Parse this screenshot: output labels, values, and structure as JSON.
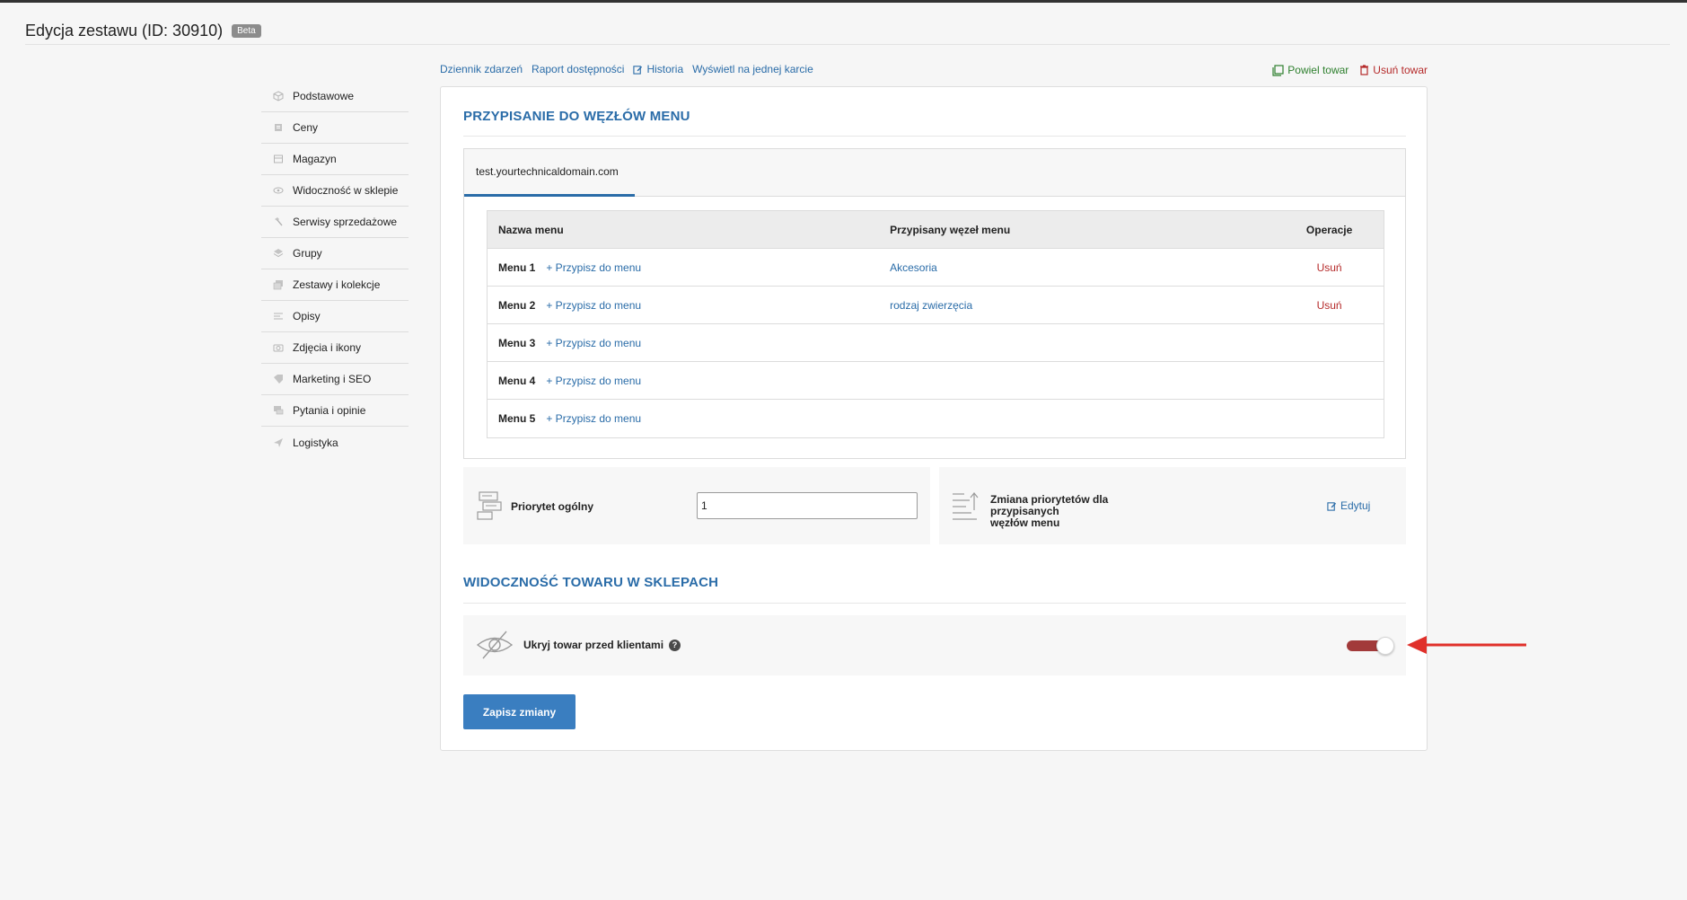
{
  "page": {
    "title": "Edycja zestawu (ID: 30910)",
    "badge": "Beta"
  },
  "sidebar": {
    "items": [
      {
        "label": "Podstawowe",
        "icon": "cube-icon"
      },
      {
        "label": "Ceny",
        "icon": "price-icon"
      },
      {
        "label": "Magazyn",
        "icon": "warehouse-icon"
      },
      {
        "label": "Widoczność w sklepie",
        "icon": "eye-icon"
      },
      {
        "label": "Serwisy sprzedażowe",
        "icon": "hammer-icon"
      },
      {
        "label": "Grupy",
        "icon": "layers-icon"
      },
      {
        "label": "Zestawy i kolekcje",
        "icon": "stack-icon"
      },
      {
        "label": "Opisy",
        "icon": "lines-icon"
      },
      {
        "label": "Zdjęcia i ikony",
        "icon": "camera-icon"
      },
      {
        "label": "Marketing i SEO",
        "icon": "tag-icon"
      },
      {
        "label": "Pytania i opinie",
        "icon": "chat-icon"
      },
      {
        "label": "Logistyka",
        "icon": "send-icon"
      }
    ]
  },
  "toplinks": {
    "events": "Dziennik zdarzeń",
    "availability": "Raport dostępności",
    "history": "Historia",
    "single_card": "Wyświetl na jednej karcie",
    "duplicate": "Powiel towar",
    "delete": "Usuń towar"
  },
  "menu_section": {
    "title": "PRZYPISANIE DO WĘZŁÓW MENU",
    "tab": "test.yourtechnicaldomain.com",
    "columns": {
      "name": "Nazwa menu",
      "node": "Przypisany węzeł menu",
      "ops": "Operacje"
    },
    "rows": [
      {
        "name": "Menu 1",
        "assign": "+ Przypisz do menu",
        "node": "Akcesoria",
        "op": "Usuń"
      },
      {
        "name": "Menu 2",
        "assign": "+ Przypisz do menu",
        "node": "rodzaj zwierzęcia",
        "op": "Usuń"
      },
      {
        "name": "Menu 3",
        "assign": "+ Przypisz do menu",
        "node": "",
        "op": ""
      },
      {
        "name": "Menu 4",
        "assign": "+ Przypisz do menu",
        "node": "",
        "op": ""
      },
      {
        "name": "Menu 5",
        "assign": "+ Przypisz do menu",
        "node": "",
        "op": ""
      }
    ],
    "priority_label": "Priorytet ogólny",
    "priority_value": "1",
    "change_priority_label_1": "Zmiana priorytetów dla przypisanych",
    "change_priority_label_2": "węzłów menu",
    "edit_label": "Edytuj"
  },
  "visibility_section": {
    "title": "WIDOCZNOŚĆ TOWARU W SKLEPACH",
    "hide_label": "Ukryj towar przed klientami",
    "help": "?",
    "toggle_on": true
  },
  "save_label": "Zapisz zmiany",
  "colors": {
    "link": "#2a6ca8",
    "danger": "#b52a2a",
    "toggle": "#a23a3a",
    "primary_button": "#3a7ec0",
    "annotation_arrow": "#e0302a"
  }
}
